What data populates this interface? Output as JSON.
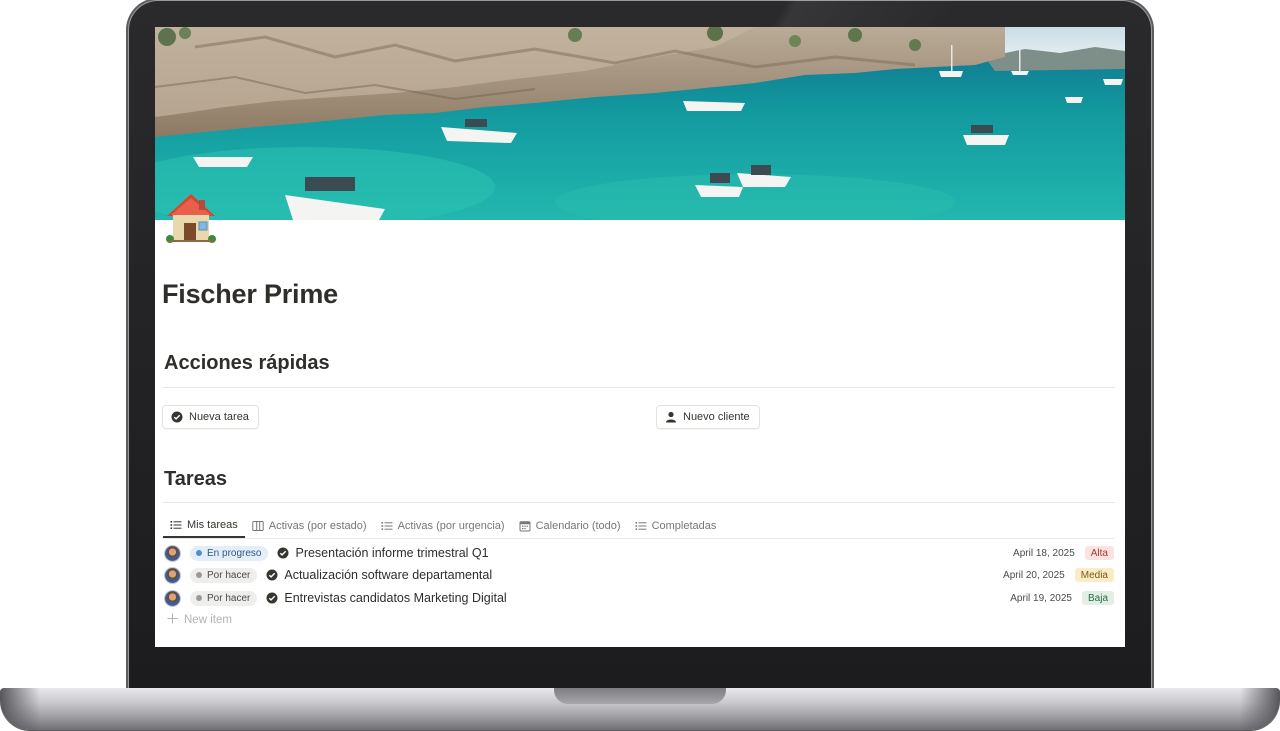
{
  "page": {
    "title": "Fischer Prime",
    "icon": "house-emoji"
  },
  "quick_actions": {
    "heading": "Acciones rápidas",
    "buttons": [
      {
        "label": "Nueva tarea",
        "icon": "check-circle-icon"
      },
      {
        "label": "Nuevo cliente",
        "icon": "person-icon"
      }
    ]
  },
  "tasks": {
    "heading": "Tareas",
    "tabs": [
      {
        "label": "Mis tareas",
        "icon": "list-icon",
        "active": true
      },
      {
        "label": "Activas (por estado)",
        "icon": "board-icon",
        "active": false
      },
      {
        "label": "Activas (por urgencia)",
        "icon": "list-icon",
        "active": false
      },
      {
        "label": "Calendario (todo)",
        "icon": "calendar-icon",
        "active": false
      },
      {
        "label": "Completadas",
        "icon": "list-icon",
        "active": false
      }
    ],
    "rows": [
      {
        "status": "En progreso",
        "name": "Presentación informe trimestral Q1",
        "date": "April 18, 2025",
        "priority": "Alta"
      },
      {
        "status": "Por hacer",
        "name": "Actualización software departamental",
        "date": "April 20, 2025",
        "priority": "Media"
      },
      {
        "status": "Por hacer",
        "name": "Entrevistas candidatos Marketing Digital",
        "date": "April 19, 2025",
        "priority": "Baja"
      }
    ],
    "new_item_label": "New item"
  },
  "colors": {
    "status_in_progress": "#4a90d9",
    "status_todo": "#9b9a97",
    "priority_alta": "#fde2e0",
    "priority_media": "#fbecc8",
    "priority_baja": "#e1efe4",
    "sea": "#1aa3a6"
  }
}
